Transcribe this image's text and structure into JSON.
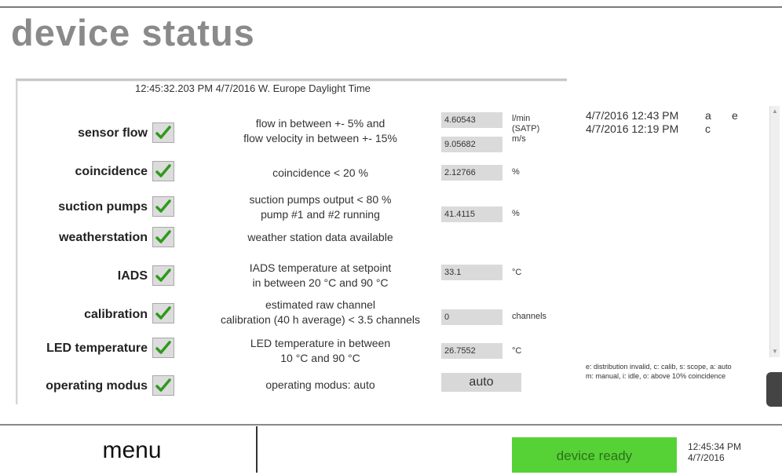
{
  "title": "device status",
  "timestamp": "12:45:32.203 PM  4/7/2016  W. Europe Daylight Time",
  "rows": [
    {
      "label": "sensor flow",
      "desc": [
        "flow in between +- 5% and",
        "flow velocity in between +- 15%"
      ],
      "values": [
        "4.60543",
        "9.05682"
      ],
      "units": [
        "l/min",
        "(SATP)",
        "m/s"
      ]
    },
    {
      "label": "coincidence",
      "desc": [
        "coincidence < 20 %"
      ],
      "values": [
        "2.12766"
      ],
      "units": [
        "%"
      ]
    },
    {
      "label": "suction pumps",
      "desc": [
        "suction pumps output < 80 %",
        "pump #1 and #2 running"
      ],
      "values": [
        "41.4115"
      ],
      "units": [
        "%"
      ]
    },
    {
      "label": "weatherstation",
      "desc": [
        "weather station data available"
      ],
      "values": [],
      "units": []
    },
    {
      "label": "IADS",
      "desc": [
        "IADS temperature at setpoint",
        "in between 20 °C and 90 °C"
      ],
      "values": [
        "33.1"
      ],
      "units": [
        "°C"
      ]
    },
    {
      "label": "calibration",
      "desc": [
        "estimated raw channel",
        "calibration (40 h average) < 3.5 channels"
      ],
      "values": [
        "0"
      ],
      "units": [
        "channels"
      ]
    },
    {
      "label": "LED temperature",
      "desc": [
        "LED temperature in between",
        "10 °C and 90 °C"
      ],
      "values": [
        "26.7552"
      ],
      "units": [
        "°C"
      ]
    },
    {
      "label": "operating modus",
      "desc": [
        "operating modus: auto"
      ],
      "values": [
        "auto"
      ],
      "units": []
    }
  ],
  "log": [
    {
      "time": "4/7/2016 12:43 PM",
      "codes": [
        "a",
        "e"
      ]
    },
    {
      "time": "4/7/2016 12:19 PM",
      "codes": [
        "c"
      ]
    }
  ],
  "legend": [
    "e: distribution invalid, c: calib, s: scope, a: auto",
    "m: manual, i: idle, o: above 10% coincidence"
  ],
  "footer": {
    "menu": "menu",
    "status": "device ready",
    "clock_time": "12:45:34 PM",
    "clock_date": "4/7/2016"
  },
  "colors": {
    "ready": "#56d236",
    "check": "#2f9a1c",
    "title": "#8a8a8a"
  },
  "icons": {
    "check": "checkmark-icon"
  }
}
